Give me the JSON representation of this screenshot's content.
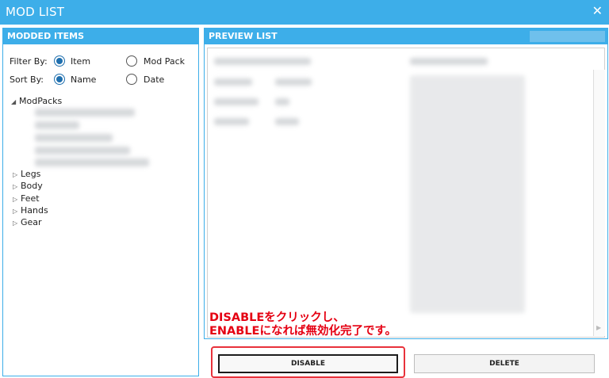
{
  "window": {
    "title": "MOD LIST",
    "close_glyph": "✕"
  },
  "left_panel": {
    "header": "MODDED ITEMS",
    "filter": {
      "label": "Filter By:",
      "options": [
        "Item",
        "Mod Pack"
      ],
      "selected": "Item"
    },
    "sort": {
      "label": "Sort By:",
      "options": [
        "Name",
        "Date"
      ],
      "selected": "Name"
    },
    "tree": {
      "root": {
        "label": "ModPacks",
        "expanded": true
      },
      "categories": [
        "Legs",
        "Body",
        "Feet",
        "Hands",
        "Gear"
      ]
    }
  },
  "right_panel": {
    "header": "PREVIEW LIST"
  },
  "buttons": {
    "disable": "DISABLE",
    "delete": "DELETE"
  },
  "annotation": {
    "line1": "DISABLEをクリックし、",
    "line2": "ENABLEになれば無効化完了です。",
    "color": "#e50012"
  },
  "colors": {
    "accent": "#3daee9",
    "selected_radio": "#1f6fae",
    "highlight": "#e8323b"
  },
  "icons": {
    "expanded": "expanded-triangle-icon",
    "collapsed": "collapsed-triangle-icon",
    "close": "close-icon"
  }
}
